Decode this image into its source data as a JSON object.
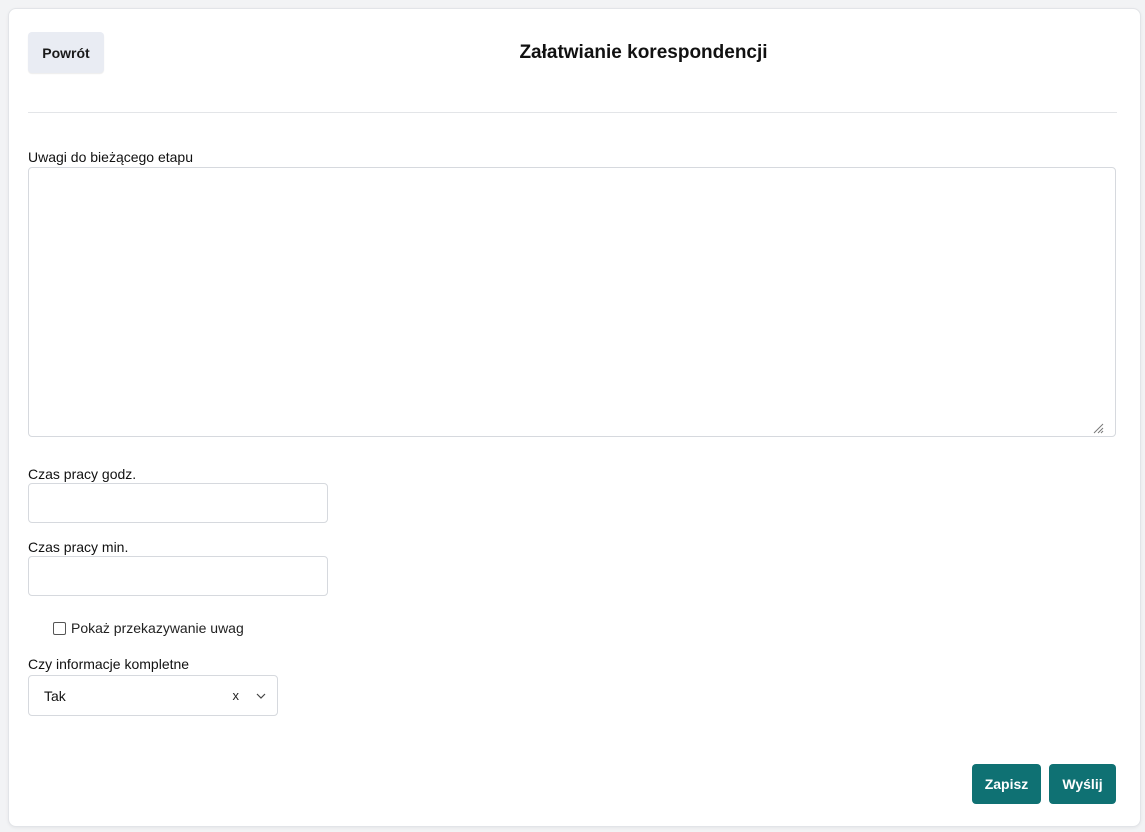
{
  "header": {
    "back_label": "Powrót",
    "title": "Załatwianie korespondencji"
  },
  "form": {
    "notes_label": "Uwagi do bieżącego etapu",
    "notes_value": "",
    "hours_label": "Czas pracy godz.",
    "hours_value": "",
    "minutes_label": "Czas pracy min.",
    "minutes_value": "",
    "show_notes_checkbox_label": "Pokaż przekazywanie uwag",
    "show_notes_checked": false,
    "complete_label": "Czy informacje kompletne",
    "complete_value": "Tak",
    "clear_symbol": "x"
  },
  "actions": {
    "save_label": "Zapisz",
    "send_label": "Wyślij"
  },
  "colors": {
    "primary": "#0f7173",
    "back_button_bg": "#e9ecf3"
  },
  "icons": {
    "select_chevron": "chevron-down-icon",
    "textarea_grip": "resize-grip-icon"
  }
}
